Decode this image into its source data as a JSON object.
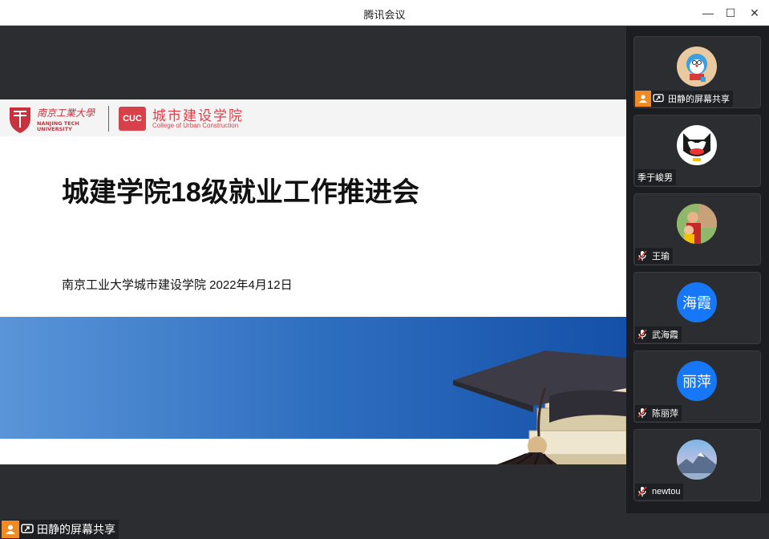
{
  "window": {
    "title": "腾讯会议",
    "minimize_symbol": "—",
    "maximize_symbol": "☐",
    "close_symbol": "✕"
  },
  "slide": {
    "university_logo": "南京工业大学 NANJING TECH UNIVERSITY",
    "college_logo_abbr": "CUC",
    "college_name": "城市建设学院",
    "college_name_en": "College of Urban Construction",
    "title": "城建学院18级就业工作推进会",
    "subtitle": "南京工业大学城市建设学院  2022年4月12日"
  },
  "share_label": {
    "text": "田静的屏幕共享"
  },
  "participants": [
    {
      "name": "田静的屏幕共享",
      "avatar_type": "cartoon-doraemon",
      "status": "sharing"
    },
    {
      "name": "季于峻男",
      "avatar_type": "cartoon-batman",
      "status": "none"
    },
    {
      "name": "王瑜",
      "avatar_type": "photo",
      "status": "muted"
    },
    {
      "name": "武海霞",
      "avatar_text": "海霞",
      "avatar_type": "text",
      "status": "muted"
    },
    {
      "name": "陈丽萍",
      "avatar_text": "丽萍",
      "avatar_type": "text",
      "status": "muted"
    },
    {
      "name": "newtou",
      "avatar_type": "landscape-photo",
      "status": "muted"
    }
  ],
  "colors": {
    "accent_orange": "#f08a24",
    "avatar_blue": "#1677f7",
    "college_red": "#d8404a"
  }
}
